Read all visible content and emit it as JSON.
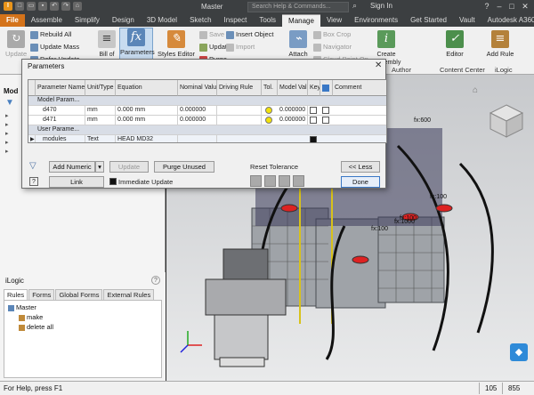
{
  "titlebar": {
    "title": "Master",
    "search": "Search Help & Commands...",
    "sign_in": "Sign In",
    "help": "?",
    "minimize": "–",
    "maximize": "□",
    "close": "✕"
  },
  "tabs": [
    "File",
    "Assemble",
    "Simplify",
    "Design",
    "3D Model",
    "Sketch",
    "Inspect",
    "Tools",
    "Manage",
    "View",
    "Environments",
    "Get Started",
    "Vault",
    "Autodesk A360"
  ],
  "active_tab": "Manage",
  "ribbon": {
    "update": "Update",
    "rebuild_all": "Rebuild All",
    "update_mass": "Update Mass",
    "defer_update": "Defer Update",
    "bill_of_materials": "Bill of Materials",
    "parameters": "Parameters",
    "styles_editor": "Styles Editor",
    "save": "Save",
    "update_styles": "Update",
    "purge": "Purge",
    "insert_object": "Insert Object",
    "import": "Import",
    "attach": "Attach",
    "box_crop": "Box Crop",
    "navigator": "Navigator",
    "cloud_point_on": "Cloud Point On",
    "create_assembly": "Create Assembly",
    "author_group": "Author",
    "editor": "Editor",
    "content_center": "Content Center",
    "add_rule": "Add Rule",
    "ilogic_group": "iLogic"
  },
  "left_panel": {
    "title": "Mod"
  },
  "ilogic_panel": {
    "title": "iLogic",
    "tabs": [
      "Rules",
      "Forms",
      "Global Forms",
      "External Rules"
    ],
    "tree": {
      "root": "Master",
      "children": [
        "make",
        "delete all"
      ]
    }
  },
  "dialog": {
    "title": "Parameters",
    "columns": [
      "Parameter Name",
      "Unit/Type",
      "Equation",
      "Nominal Value",
      "Driving Rule",
      "Tol.",
      "Model Value",
      "Key",
      "",
      "Comment"
    ],
    "groups": [
      {
        "label": "Model Param...",
        "rows": [
          {
            "name": "d470",
            "unit": "mm",
            "equation": "0.000 mm",
            "nominal": "0.000000",
            "model": "0.000000"
          },
          {
            "name": "d471",
            "unit": "mm",
            "equation": "0.000 mm",
            "nominal": "0.000000",
            "model": "0.000000"
          }
        ]
      },
      {
        "label": "User Parame...",
        "rows": [
          {
            "name": "modules",
            "unit": "Text",
            "equation": "HEAD MD32",
            "nominal": "",
            "model": ""
          }
        ]
      }
    ],
    "buttons": {
      "add_numeric": "Add Numeric",
      "update": "Update",
      "purge_unused": "Purge Unused",
      "less": "<< Less",
      "link": "Link",
      "immediate_update": "Immediate Update",
      "done": "Done",
      "reset_tolerance": "Reset Tolerance"
    }
  },
  "viewport": {
    "dims": [
      "fx:600",
      "fx:100",
      "fx:100",
      "fx:100",
      "fx:1000"
    ]
  },
  "status": {
    "text": "For Help, press F1",
    "count1": "105",
    "count2": "855"
  }
}
